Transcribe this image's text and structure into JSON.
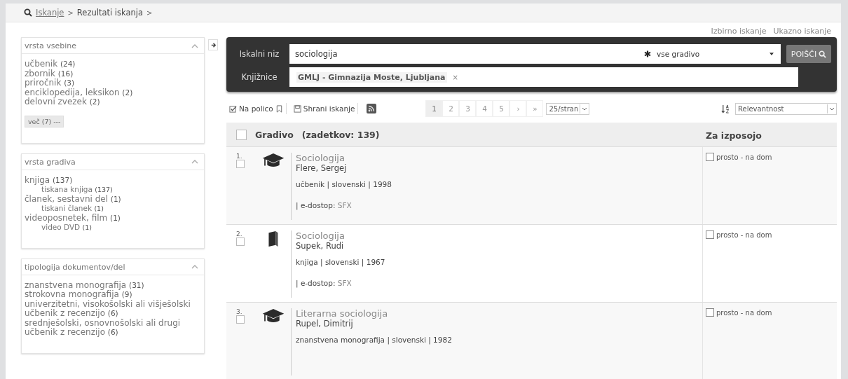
{
  "breadcrumb": {
    "items": [
      {
        "label": "Iskanje",
        "kind": "link"
      },
      {
        "label": "Rezultati iskanja",
        "kind": "current"
      }
    ],
    "separator": ">"
  },
  "top_links": [
    "Izbirno iskanje",
    "Ukazno iskanje"
  ],
  "facets": [
    {
      "title": "vrsta vsebine",
      "expanded": true,
      "items": [
        {
          "label": "učbenik",
          "count": "(24)"
        },
        {
          "label": "zbornik",
          "count": "(16)"
        },
        {
          "label": "priročnik",
          "count": "(3)"
        },
        {
          "label": "enciklopedija, leksikon",
          "count": "(2)"
        },
        {
          "label": "delovni zvezek",
          "count": "(2)"
        }
      ],
      "more": "več (7) ---"
    },
    {
      "title": "vrsta gradiva",
      "expanded": true,
      "items": [
        {
          "label": "knjiga",
          "count": "(137)",
          "children": [
            {
              "label": "tiskana knjiga",
              "count": "(137)"
            }
          ]
        },
        {
          "label": "članek, sestavni del",
          "count": "(1)",
          "children": [
            {
              "label": "tiskani članek",
              "count": "(1)"
            }
          ]
        },
        {
          "label": "videoposnetek, film",
          "count": "(1)",
          "children": [
            {
              "label": "video DVD",
              "count": "(1)"
            }
          ]
        }
      ]
    },
    {
      "title": "tipologija dokumentov/del",
      "expanded": true,
      "items": [
        {
          "label": "znanstvena monografija",
          "count": "(31)"
        },
        {
          "label": "strokovna monografija",
          "count": "(9)"
        },
        {
          "label": "univerzitetni, visokošolski ali višješolski učbenik z recenzijo",
          "count": "(6)"
        },
        {
          "label": "srednješolski, osnovnošolski ali drugi učbenik z recenzijo",
          "count": "(6)"
        }
      ]
    }
  ],
  "search": {
    "query_label": "Iskalni niz",
    "query": "sociologija",
    "material": "vse gradivo",
    "button": "POIŠČI",
    "libraries_label": "Knjižnice",
    "library_tag": "GMLJ - Gimnazija Moste, Ljubljana",
    "tag_remove": "×"
  },
  "toolbar": {
    "shelf": "Na polico",
    "save": "Shrani iskanje",
    "pages": [
      {
        "label": "1",
        "selected": true
      },
      {
        "label": "2",
        "selected": false
      },
      {
        "label": "3",
        "selected": false
      },
      {
        "label": "4",
        "selected": false
      },
      {
        "label": "5",
        "selected": false
      }
    ],
    "next": "›",
    "last": "»",
    "per_page": "25/stran",
    "sort": "Relevantnost"
  },
  "table": {
    "select_all_checked": false,
    "title": "Gradivo",
    "count": "(zadetkov: 139)",
    "availability_header": "Za izposojo",
    "rows": [
      {
        "number": "1.",
        "checked": false,
        "kind": "textbook",
        "title": "Sociologija",
        "author": "Flere, Sergej",
        "meta": "učbenik | slovenski | 1998",
        "access_prefix": "| e-dostop:",
        "access_link": "SFX",
        "availability": "prosto - na dom",
        "available_checked": false
      },
      {
        "number": "2.",
        "checked": false,
        "kind": "book",
        "title": "Sociologija",
        "author": "Supek, Rudi",
        "meta": "knjiga | slovenski | 1967",
        "access_prefix": "| e-dostop:",
        "access_link": "SFX",
        "availability": "prosto - na dom",
        "available_checked": false
      },
      {
        "number": "3.",
        "checked": false,
        "kind": "textbook",
        "title": "Literarna sociologija",
        "author": "Rupel, Dimitrij",
        "meta": "znanstvena monografija | slovenski | 1982",
        "availability": "prosto - na dom",
        "available_checked": false
      }
    ]
  }
}
